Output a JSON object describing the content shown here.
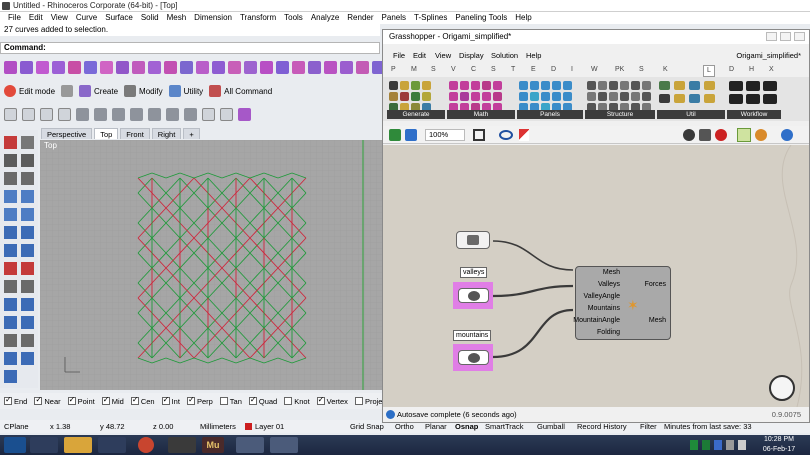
{
  "rhino": {
    "title": "Untitled - Rhinoceros Corporate (64-bit) - [Top]",
    "menu": [
      "File",
      "Edit",
      "View",
      "Curve",
      "Surface",
      "Solid",
      "Mesh",
      "Dimension",
      "Transform",
      "Tools",
      "Analyze",
      "Render",
      "Panels",
      "T-Splines",
      "Paneling Tools",
      "Help"
    ],
    "status_message": "27 curves added to selection.",
    "command_label": "Command:",
    "toolbar2": {
      "edit_mode": "Edit mode",
      "create": "Create",
      "modify": "Modify",
      "utility": "Utility",
      "all_command": "All Command"
    },
    "viewport_tabs": [
      "Perspective",
      "Top",
      "Front",
      "Right"
    ],
    "active_tab": "Top",
    "viewport_label": "Top",
    "osnap": [
      "End",
      "Near",
      "Point",
      "Mid",
      "Cen",
      "Int",
      "Perp",
      "Tan",
      "Quad",
      "Knot",
      "Vertex",
      "Project",
      "Disable"
    ],
    "osnap_checked": [
      true,
      true,
      true,
      true,
      true,
      true,
      true,
      false,
      true,
      false,
      true,
      false,
      false
    ],
    "statusbar": {
      "cplane": "CPlane",
      "x": "x 1.38",
      "y": "y 48.72",
      "z": "z 0.00",
      "units": "Millimeters",
      "layer": "Layer 01",
      "grid_snap": "Grid Snap",
      "ortho": "Ortho",
      "planar": "Planar",
      "osnap": "Osnap",
      "smarttrack": "SmartTrack",
      "gumball": "Gumball",
      "record_history": "Record History",
      "filter": "Filter",
      "last_save": "Minutes from last save: 33"
    },
    "layer_color": "#cc1f1f",
    "pattern_colors": {
      "mountain": "#1f9a3a",
      "valley": "#d0243a",
      "viewport_bg": "#a6a6a6"
    }
  },
  "grasshopper": {
    "title": "Grasshopper - Origami_simplified*",
    "menu": [
      "File",
      "Edit",
      "View",
      "Display",
      "Solution",
      "Help"
    ],
    "doc_name": "Origami_simplified*",
    "tabs": [
      "P",
      "M",
      "S",
      "V",
      "C",
      "S",
      "T",
      "E",
      "D",
      "I",
      "W",
      "PK",
      "S",
      "K",
      "L",
      "D",
      "H",
      "X"
    ],
    "active_tab": "L",
    "ribbon_groups": [
      "Generate",
      "Math",
      "Panels",
      "Structure",
      "Util",
      "Workflow"
    ],
    "zoom": "100%",
    "params": {
      "valleys": "valleys",
      "mountains": "mountains"
    },
    "component": {
      "inputs": [
        "Mesh",
        "Valleys",
        "ValleyAngle",
        "Mountains",
        "MountainAngle",
        "Folding"
      ],
      "outputs": [
        "Forces",
        "Mesh"
      ]
    },
    "status": "Autosave complete (6 seconds ago)",
    "version": "0.9.0075",
    "param_color": "#e07ee6"
  },
  "taskbar": {
    "time": "10:28 PM",
    "date": "06-Feb-17",
    "apps": [
      "file-explorer",
      "chrome",
      "muse",
      "rhino",
      "grasshopper"
    ],
    "muse_label": "Mu"
  }
}
